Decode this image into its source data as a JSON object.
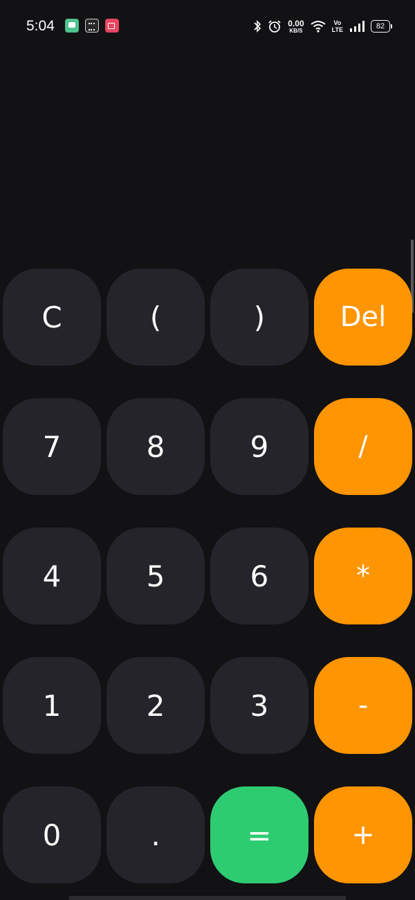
{
  "status_bar": {
    "time": "5:04",
    "notification_icons": [
      "chat-app-icon",
      "keypad-app-icon",
      "video-app-icon"
    ],
    "net_speed_value": "0.00",
    "net_speed_unit": "KB/S",
    "volte_top": "Vo",
    "volte_bottom": "LTE",
    "battery_level": "82"
  },
  "display": {
    "expression": ""
  },
  "keypad": {
    "row1": [
      "C",
      "(",
      ")",
      "Del"
    ],
    "row2": [
      "7",
      "8",
      "9",
      "/"
    ],
    "row3": [
      "4",
      "5",
      "6",
      "*"
    ],
    "row4": [
      "1",
      "2",
      "3",
      "-"
    ],
    "row5": [
      "0",
      ".",
      "=",
      "+"
    ]
  },
  "colors": {
    "background": "#121114",
    "number_key": "#25242a",
    "operator_key": "#ff9500",
    "equals_key": "#2ecc71",
    "text": "#ffffff"
  }
}
